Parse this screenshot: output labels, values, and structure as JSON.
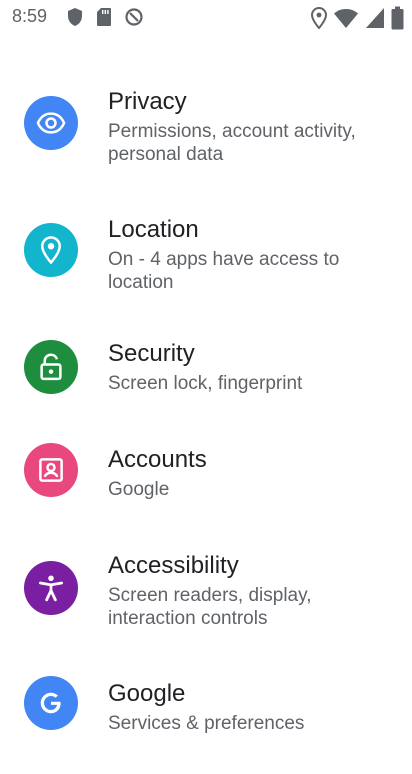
{
  "status_bar": {
    "time": "8:59"
  },
  "settings": {
    "items": [
      {
        "title": "Privacy",
        "subtitle": "Permissions, account activity, personal data",
        "icon": "eye-icon",
        "color": "#4285f4"
      },
      {
        "title": "Location",
        "subtitle": "On - 4 apps have access to location",
        "icon": "location-pin-icon",
        "color": "#12b5cb"
      },
      {
        "title": "Security",
        "subtitle": "Screen lock, fingerprint",
        "icon": "unlock-icon",
        "color": "#1e8e3e"
      },
      {
        "title": "Accounts",
        "subtitle": "Google",
        "icon": "account-card-icon",
        "color": "#e8487e"
      },
      {
        "title": "Accessibility",
        "subtitle": "Screen readers, display, interaction controls",
        "icon": "accessibility-icon",
        "color": "#7b1fa2"
      },
      {
        "title": "Google",
        "subtitle": "Services & preferences",
        "icon": "google-g-icon",
        "color": "#4285f4"
      }
    ]
  }
}
